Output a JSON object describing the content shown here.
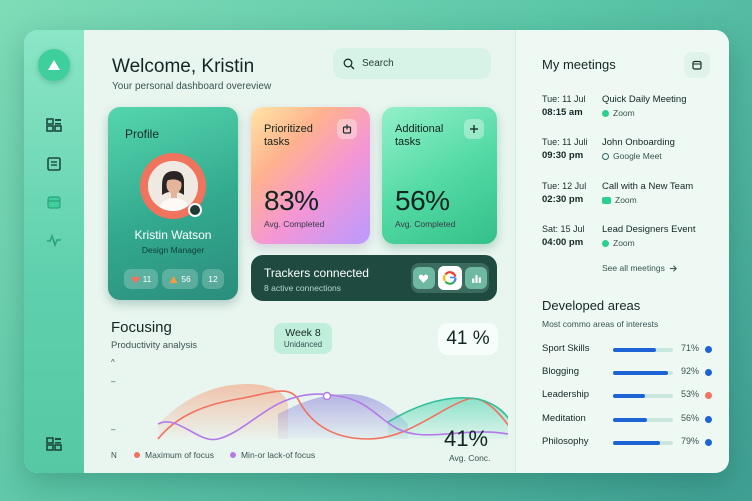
{
  "header": {
    "welcome": "Welcome, Kristin",
    "subtitle": "Your personal dashboard overeview",
    "search_placeholder": "Search"
  },
  "sidebar": {
    "items": [
      {
        "icon": "dashboard-grid-icon"
      },
      {
        "icon": "document-icon"
      },
      {
        "icon": "calendar-icon"
      },
      {
        "icon": "activity-icon"
      },
      {
        "icon": "dashboard-grid-icon"
      }
    ]
  },
  "profile": {
    "title": "Profile",
    "name": "Kristin Watson",
    "role": "Design Manager",
    "stats": [
      {
        "icon": "heart-icon",
        "value": "11"
      },
      {
        "icon": "triangle-icon",
        "value": "56"
      },
      {
        "icon": "none",
        "value": "12"
      }
    ]
  },
  "tasks": [
    {
      "label": "Prioritized tasks",
      "percent": "83%",
      "sub": "Avg. Completed",
      "button_icon": "export-icon"
    },
    {
      "label": "Additional tasks",
      "percent": "56%",
      "sub": "Avg. Completed",
      "button_icon": "plus-icon"
    }
  ],
  "trackers": {
    "title": "Trackers connected",
    "sub": "8 active connections"
  },
  "focusing": {
    "title": "Focusing",
    "subtitle": "Productivity analysis",
    "week_label": "Week 8",
    "week_sub": "Unidanced",
    "top_percent": "41 %",
    "avg_percent": "41%",
    "avg_label": "Avg. Conc.",
    "y_labels": [
      "^",
      "–",
      "–",
      "N"
    ],
    "legend": [
      {
        "label": "Maximum of focus",
        "color": "#f2715f"
      },
      {
        "label": "Min-or lack-of focus",
        "color": "#b47be8"
      }
    ]
  },
  "meetings": {
    "title": "My meetings",
    "items": [
      {
        "date": "Tue: 11 Jul",
        "time": "08:15 am",
        "name": "Quick Daily Meeting",
        "app": "Zoom",
        "app_icon": "round"
      },
      {
        "date": "Tue: 11 Juli",
        "time": "09:30 pm",
        "name": "John Onboarding",
        "app": "Google Meet",
        "app_icon": "ring"
      },
      {
        "date": "Tue: 12 Jul",
        "time": "02:30 pm",
        "name": "Call with a New Team",
        "app": "Zoom",
        "app_icon": "rect"
      },
      {
        "date": "Sat: 15 Jul",
        "time": "04:00 pm",
        "name": "Lead Designers Event",
        "app": "Zoom",
        "app_icon": "round"
      }
    ],
    "see_all": "See all meetings"
  },
  "developed": {
    "title": "Developed areas",
    "subtitle": "Most commo areas of interests",
    "items": [
      {
        "name": "Sport Skills",
        "percent": "71%",
        "value": 0.71,
        "dot_color": "#1e63d6"
      },
      {
        "name": "Blogging",
        "percent": "92%",
        "value": 0.92,
        "dot_color": "#1e63d6"
      },
      {
        "name": "Leadership",
        "percent": "53%",
        "value": 0.53,
        "dot_color": "#f2715f"
      },
      {
        "name": "Meditation",
        "percent": "56%",
        "value": 0.56,
        "dot_color": "#1e63d6"
      },
      {
        "name": "Philosophy",
        "percent": "79%",
        "value": 0.79,
        "dot_color": "#1e63d6"
      }
    ]
  }
}
